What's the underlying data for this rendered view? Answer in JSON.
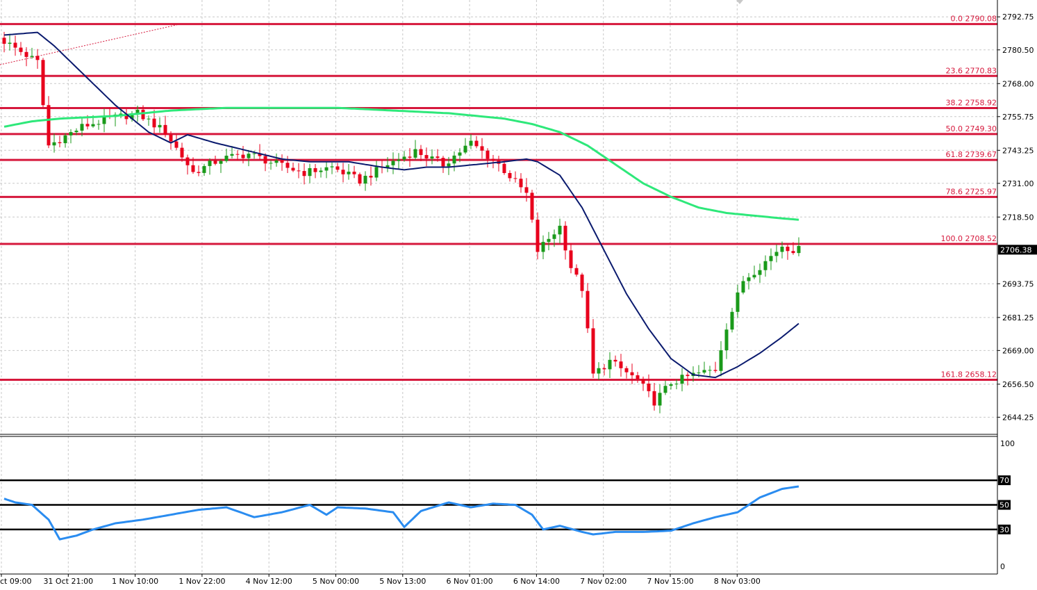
{
  "colors": {
    "background": "#ffffff",
    "grid": "#c8c8c8",
    "bull": "#1a9a1a",
    "bear": "#e8001c",
    "fib_line": "#d6183c",
    "ma_fast": "#0a1a6e",
    "ma_slow": "#2ee87a",
    "rsi": "#2a8cf0",
    "price_tag_bg": "#000000"
  },
  "chart_data": [
    {
      "type": "candlestick",
      "title": "",
      "xlabel": "",
      "ylabel": "",
      "ylim": [
        2637.9,
        2799.0
      ],
      "grid": true,
      "y_ticks": [
        "2792.75",
        "2780.50",
        "2768.00",
        "2755.75",
        "2743.25",
        "2731.00",
        "2718.50",
        "2706.38",
        "2693.75",
        "2681.25",
        "2669.00",
        "2656.50",
        "2644.25"
      ],
      "x_ticks": [
        "ct 09:00",
        "31 Oct 21:00",
        "1 Nov 10:00",
        "1 Nov 22:00",
        "4 Nov 12:00",
        "5 Nov 00:00",
        "5 Nov 13:00",
        "6 Nov 01:00",
        "6 Nov 14:00",
        "7 Nov 02:00",
        "7 Nov 15:00",
        "8 Nov 03:00"
      ],
      "current_price": "2706.38",
      "fib_levels": [
        {
          "label": "0.0 2790.08",
          "value": 2790.08
        },
        {
          "label": "23.6 2770.83",
          "value": 2770.83
        },
        {
          "label": "38.2 2758.92",
          "value": 2758.92
        },
        {
          "label": "50.0 2749.30",
          "value": 2749.3
        },
        {
          "label": "61.8 2739.67",
          "value": 2739.67
        },
        {
          "label": "78.6 2725.97",
          "value": 2725.97
        },
        {
          "label": "100.0 2708.52",
          "value": 2708.52
        },
        {
          "label": "161.8 2658.12",
          "value": 2658.12
        }
      ],
      "candle_anchors": [
        [
          0,
          2785
        ],
        [
          7,
          2776
        ],
        [
          8,
          2760
        ],
        [
          9,
          2745
        ],
        [
          15,
          2752
        ],
        [
          20,
          2755
        ],
        [
          25,
          2757
        ],
        [
          30,
          2750
        ],
        [
          35,
          2735
        ],
        [
          40,
          2740
        ],
        [
          45,
          2742
        ],
        [
          50,
          2738
        ],
        [
          55,
          2735
        ],
        [
          60,
          2737
        ],
        [
          65,
          2732
        ],
        [
          70,
          2738
        ],
        [
          75,
          2743
        ],
        [
          80,
          2738
        ],
        [
          85,
          2746
        ],
        [
          90,
          2738
        ],
        [
          95,
          2727
        ],
        [
          97,
          2706
        ],
        [
          101,
          2715
        ],
        [
          103,
          2700
        ],
        [
          105,
          2692
        ],
        [
          107,
          2660
        ],
        [
          110,
          2665
        ],
        [
          115,
          2658
        ],
        [
          118,
          2650
        ],
        [
          121,
          2657
        ],
        [
          125,
          2660
        ],
        [
          129,
          2662
        ],
        [
          131,
          2678
        ],
        [
          134,
          2695
        ],
        [
          138,
          2702
        ],
        [
          141,
          2708
        ],
        [
          143,
          2706.38
        ]
      ],
      "candle_count": 144,
      "ma_fast": [
        [
          0,
          2786
        ],
        [
          6,
          2787
        ],
        [
          9,
          2782
        ],
        [
          14,
          2772
        ],
        [
          20,
          2760
        ],
        [
          26,
          2750
        ],
        [
          30,
          2746
        ],
        [
          33,
          2749
        ],
        [
          38,
          2746
        ],
        [
          44,
          2743
        ],
        [
          50,
          2740
        ],
        [
          55,
          2739
        ],
        [
          62,
          2739
        ],
        [
          68,
          2737
        ],
        [
          72,
          2736
        ],
        [
          76,
          2737
        ],
        [
          80,
          2737
        ],
        [
          85,
          2738
        ],
        [
          90,
          2739
        ],
        [
          94,
          2740
        ],
        [
          96,
          2739
        ],
        [
          100,
          2734
        ],
        [
          104,
          2722
        ],
        [
          108,
          2706
        ],
        [
          112,
          2690
        ],
        [
          116,
          2677
        ],
        [
          120,
          2666
        ],
        [
          124,
          2660
        ],
        [
          128,
          2659
        ],
        [
          132,
          2663
        ],
        [
          136,
          2668
        ],
        [
          140,
          2674
        ],
        [
          143,
          2679
        ]
      ],
      "ma_slow": [
        [
          0,
          2752
        ],
        [
          5,
          2754
        ],
        [
          10,
          2755
        ],
        [
          20,
          2756
        ],
        [
          30,
          2758
        ],
        [
          40,
          2759
        ],
        [
          50,
          2759
        ],
        [
          60,
          2759
        ],
        [
          70,
          2758
        ],
        [
          80,
          2757
        ],
        [
          90,
          2755
        ],
        [
          95,
          2753
        ],
        [
          100,
          2750
        ],
        [
          105,
          2745
        ],
        [
          110,
          2738
        ],
        [
          115,
          2731
        ],
        [
          120,
          2726
        ],
        [
          125,
          2722
        ],
        [
          130,
          2720
        ],
        [
          135,
          2719
        ],
        [
          140,
          2718
        ],
        [
          143,
          2717.5
        ]
      ]
    },
    {
      "type": "line",
      "title": "",
      "ylim": [
        0,
        100
      ],
      "y_ticks": [
        "100",
        "70",
        "50",
        "30",
        "0"
      ],
      "levels": [
        70,
        50,
        30
      ],
      "rsi": [
        [
          0,
          55
        ],
        [
          2,
          52
        ],
        [
          5,
          50
        ],
        [
          8,
          38
        ],
        [
          10,
          22
        ],
        [
          13,
          25
        ],
        [
          16,
          30
        ],
        [
          20,
          35
        ],
        [
          25,
          38
        ],
        [
          30,
          42
        ],
        [
          35,
          46
        ],
        [
          40,
          48
        ],
        [
          45,
          40
        ],
        [
          50,
          44
        ],
        [
          55,
          50
        ],
        [
          58,
          42
        ],
        [
          60,
          48
        ],
        [
          65,
          47
        ],
        [
          70,
          44
        ],
        [
          72,
          32
        ],
        [
          75,
          45
        ],
        [
          80,
          52
        ],
        [
          84,
          48
        ],
        [
          88,
          51
        ],
        [
          92,
          50
        ],
        [
          95,
          42
        ],
        [
          97,
          30
        ],
        [
          100,
          33
        ],
        [
          104,
          28
        ],
        [
          106,
          26
        ],
        [
          110,
          28
        ],
        [
          115,
          28
        ],
        [
          120,
          29
        ],
        [
          124,
          35
        ],
        [
          128,
          40
        ],
        [
          132,
          44
        ],
        [
          136,
          56
        ],
        [
          140,
          63
        ],
        [
          143,
          65
        ]
      ]
    }
  ]
}
